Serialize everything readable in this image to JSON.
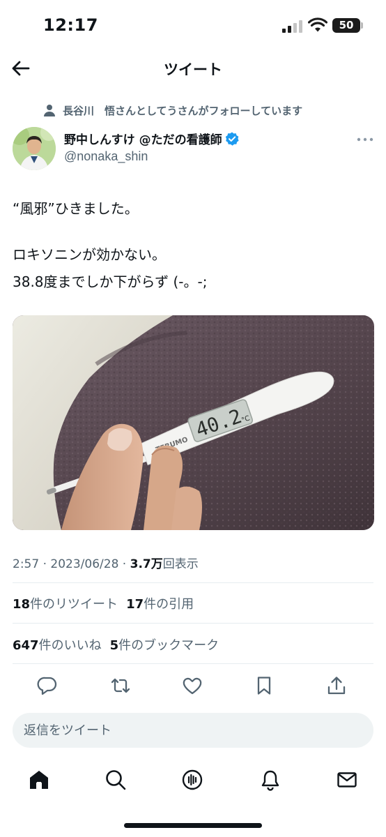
{
  "status_bar": {
    "time": "12:17",
    "battery": "50"
  },
  "header": {
    "title": "ツイート"
  },
  "social_context": {
    "text": "長谷川　悟さんとしてうさんがフォローしています"
  },
  "author": {
    "name": "野中しんすけ @ただの看護師",
    "handle": "@nonaka_shin"
  },
  "tweet": {
    "lines": [
      "“風邪”ひきました。",
      "ロキソニンが効かない。",
      "38.8度までしか下がらず (-。-;"
    ],
    "photo": {
      "thermometer_reading": "40.2",
      "thermometer_unit": "°C",
      "brand": "TERUMO"
    }
  },
  "meta": {
    "time": "2:57",
    "separator": " · ",
    "date": "2023/06/28",
    "views_value": "3.7万",
    "views_label": "回表示"
  },
  "stats": {
    "retweets_value": "18",
    "retweets_label": "件のリツイート",
    "quotes_value": "17",
    "quotes_label": "件の引用",
    "likes_value": "647",
    "likes_label": "件のいいね",
    "bookmarks_value": "5",
    "bookmarks_label": "件のブックマーク"
  },
  "reply": {
    "placeholder": "返信をツイート"
  },
  "icons": {
    "back": "arrow-left-icon",
    "person": "person-icon",
    "verified": "verified-badge-icon",
    "more": "more-dots-icon",
    "reply": "reply-icon",
    "retweet": "retweet-icon",
    "like": "heart-icon",
    "bookmark": "bookmark-icon",
    "share": "share-icon",
    "home": "home-icon",
    "search": "search-icon",
    "spaces": "spaces-icon",
    "notifications": "bell-icon",
    "messages": "mail-icon"
  },
  "colors": {
    "text": "#0f1419",
    "secondary": "#536471",
    "verified": "#1d9bf0",
    "reply_bg": "#eff3f4"
  }
}
